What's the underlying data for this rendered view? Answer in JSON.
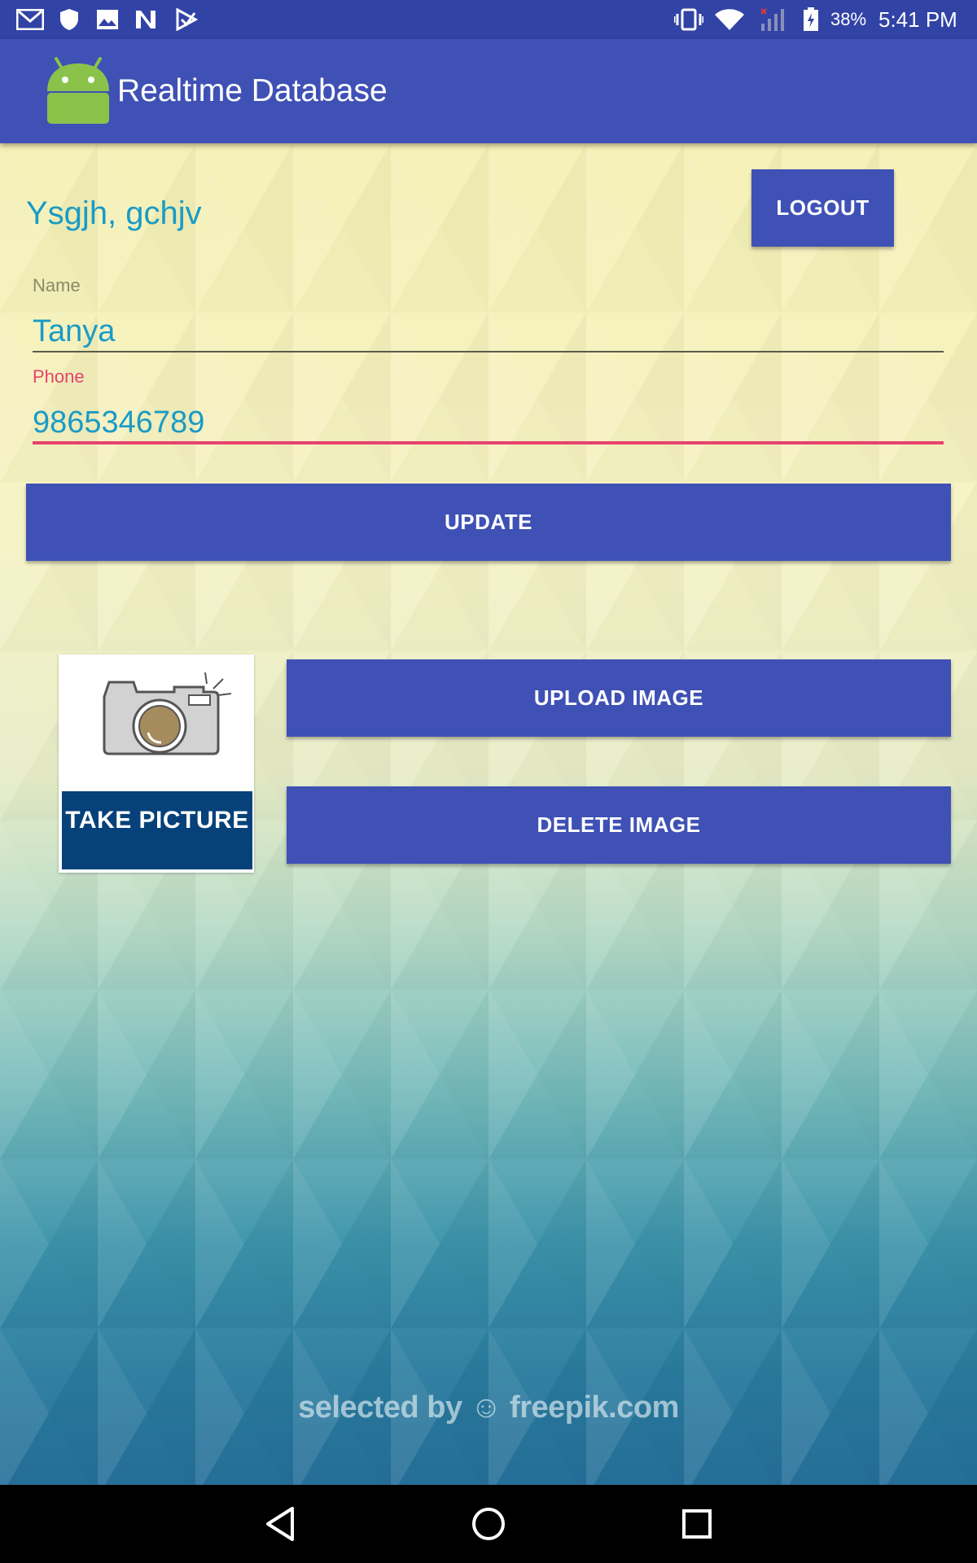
{
  "status_bar": {
    "battery": "38%",
    "time": "5:41 PM",
    "left_icons": [
      "gmail-icon",
      "shield-icon",
      "image-icon",
      "n-icon",
      "play-store-icon"
    ],
    "right_icons": [
      "vibrate-icon",
      "wifi-icon",
      "signal-icon",
      "battery-icon"
    ]
  },
  "app_bar": {
    "title": "Realtime Database",
    "logo": "android-logo"
  },
  "main": {
    "greeting": "Ysgjh, gchjv",
    "logout_label": "LOGOUT",
    "name_label": "Name",
    "name_value": "Tanya",
    "phone_label": "Phone",
    "phone_value": "9865346789",
    "update_label": "UPDATE",
    "take_picture_text": "TAKE PICTURE",
    "upload_label": "UPLOAD IMAGE",
    "delete_label": "DELETE IMAGE",
    "watermark": "selected by ☺ freepik.com"
  },
  "nav_bar": {
    "icons": [
      "back-icon",
      "home-icon",
      "recents-icon"
    ]
  },
  "colors": {
    "primary": "#3f51b5",
    "accent": "#e8416e",
    "text_blue": "#1a9bc6"
  }
}
